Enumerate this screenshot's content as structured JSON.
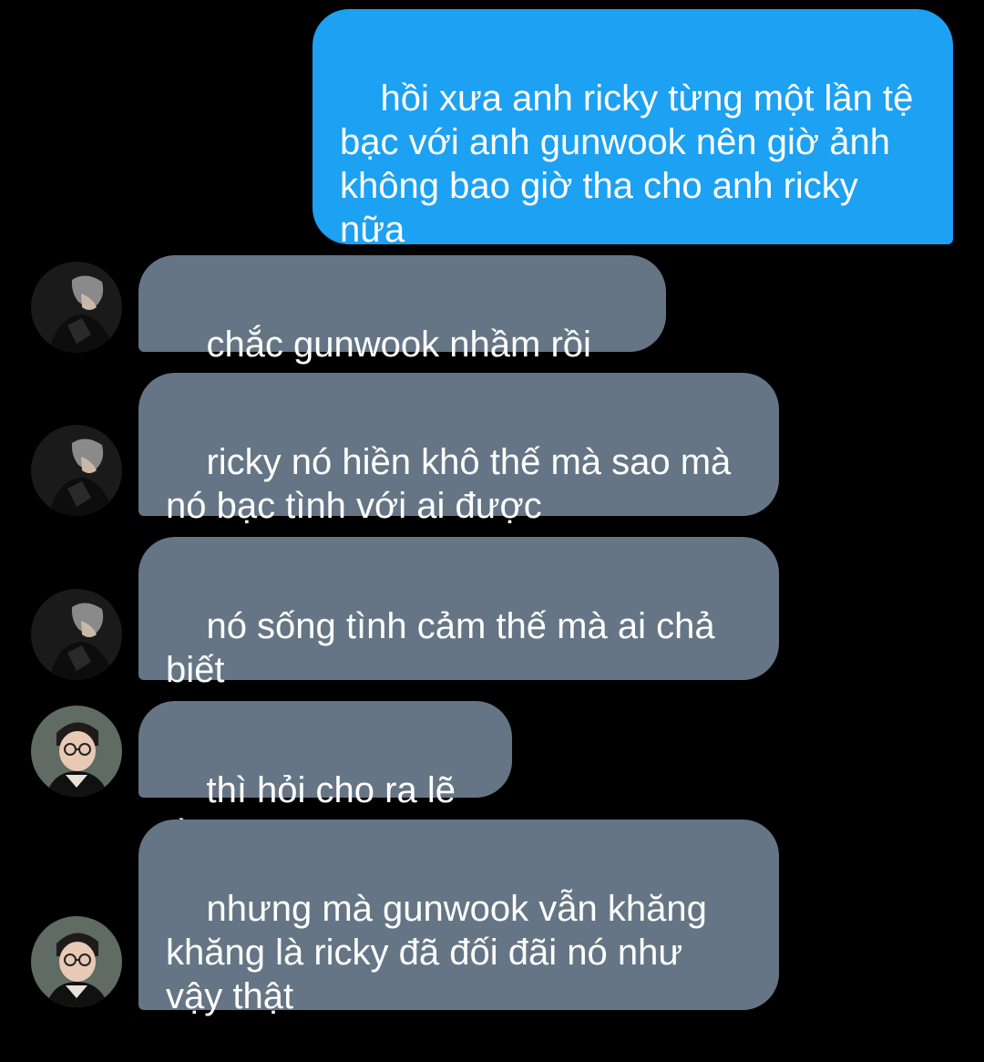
{
  "colors": {
    "background": "#000000",
    "outgoing_bubble": "#1da1f2",
    "incoming_bubble": "#657585",
    "text": "#ffffff"
  },
  "messages": [
    {
      "direction": "outgoing",
      "text": "hồi xưa anh ricky từng một lần tệ\nbạc với anh gunwook nên giờ ảnh\nkhông bao giờ tha cho anh ricky\nnữa"
    },
    {
      "direction": "incoming",
      "avatar": "avatar-dark-hair-icon",
      "text": "chắc gunwook nhầm rồi đó"
    },
    {
      "direction": "incoming",
      "avatar": "avatar-dark-hair-icon",
      "text": "ricky nó hiền khô thế mà sao mà\nnó bạc tình với ai được"
    },
    {
      "direction": "incoming",
      "avatar": "avatar-dark-hair-icon",
      "text": "nó sống tình cảm thế mà ai chả\nbiết"
    },
    {
      "direction": "incoming",
      "avatar": "avatar-glasses-icon",
      "text": "thì hỏi cho ra lẽ rồi"
    },
    {
      "direction": "incoming",
      "avatar": "avatar-glasses-icon",
      "text": "nhưng mà gunwook vẫn khăng\nkhăng là ricky đã đối đãi nó như\nvậy thật"
    }
  ]
}
